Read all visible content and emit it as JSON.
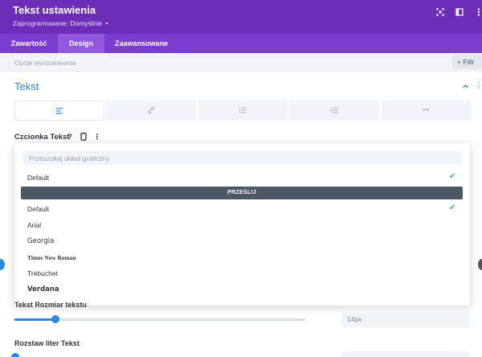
{
  "header": {
    "title": "Tekst ustawienia",
    "subtitle": "Zaprogramowane: Domyślnie",
    "subtitle_caret": "▾",
    "icons": [
      "fullscreen-icon",
      "split-view-icon",
      "more-icon"
    ]
  },
  "tabs": [
    {
      "label": "Zawartość",
      "active": false
    },
    {
      "label": "Design",
      "active": true
    },
    {
      "label": "Zaawansowane",
      "active": false
    }
  ],
  "filter": {
    "search_placeholder": "Opcje wyszukiwania",
    "filter_label": "+ Filtr"
  },
  "section": {
    "title": "Tekst",
    "collapse_glyph": "^",
    "menu_glyph": "⋮"
  },
  "style_tabs": [
    "align-left-icon",
    "link-icon",
    "unordered-list-icon",
    "ordered-list-icon",
    "quote-icon"
  ],
  "font_control": {
    "label": "Czcionka Tekst",
    "help": "?",
    "menu": "⋮"
  },
  "dropdown": {
    "search_placeholder": "Przeszukaj układ graficzny",
    "current": "Default",
    "upload_label": "PRZEŚLIJ",
    "fonts": [
      "Default",
      "Arial",
      "Georgia",
      "Times New Roman",
      "Trebuchet",
      "Verdana"
    ],
    "selected_index": 0,
    "check": "✔"
  },
  "size_control": {
    "label": "Tekst Rozmiar tekstu",
    "value": "14px",
    "slider_fraction": 0.14
  },
  "spacing_control": {
    "label": "Rozstaw liter Tekst"
  },
  "colors": {
    "header": "#6c2eb9",
    "tabs": "#7b3cd0",
    "accent": "#2b87da",
    "check": "#3cb878",
    "upload": "#4c5866"
  }
}
